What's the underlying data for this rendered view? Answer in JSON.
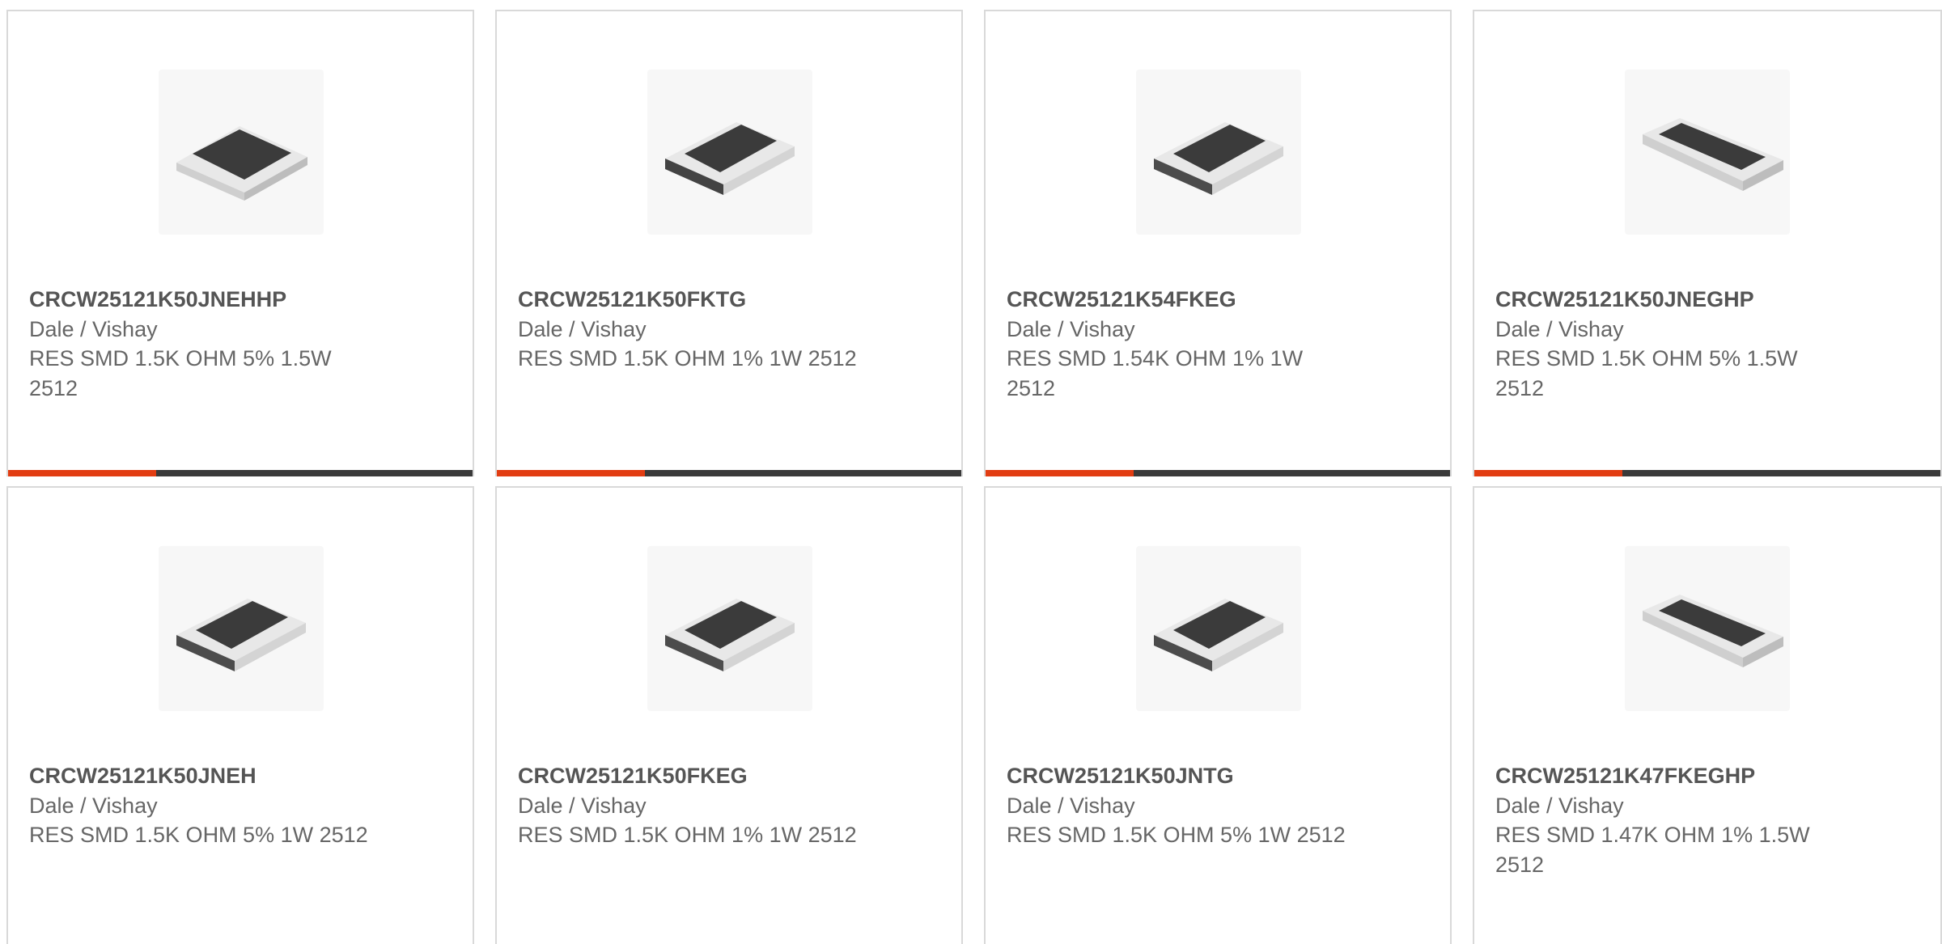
{
  "colors": {
    "accent": "#e23d12",
    "bar": "#3a3a3a",
    "border": "#d9d9d9",
    "text": "#666666",
    "part_text": "#555555"
  },
  "products": [
    {
      "part": "CRCW25121K50JNEHHP",
      "brand": "Dale / Vishay",
      "desc": "RES SMD 1.5K OHM 5% 1.5W 2512",
      "icon": "resistor-chip-icon"
    },
    {
      "part": "CRCW25121K50FKTG",
      "brand": "Dale / Vishay",
      "desc": "RES SMD 1.5K OHM 1% 1W 2512",
      "icon": "resistor-chip-icon"
    },
    {
      "part": "CRCW25121K54FKEG",
      "brand": "Dale / Vishay",
      "desc": "RES SMD 1.54K OHM 1% 1W 2512",
      "icon": "resistor-chip-icon"
    },
    {
      "part": "CRCW25121K50JNEGHP",
      "brand": "Dale / Vishay",
      "desc": "RES SMD 1.5K OHM 5% 1.5W 2512",
      "icon": "resistor-chip-icon"
    },
    {
      "part": "CRCW25121K50JNEH",
      "brand": "Dale / Vishay",
      "desc": "RES SMD 1.5K OHM 5% 1W 2512",
      "icon": "resistor-chip-icon"
    },
    {
      "part": "CRCW25121K50FKEG",
      "brand": "Dale / Vishay",
      "desc": "RES SMD 1.5K OHM 1% 1W 2512",
      "icon": "resistor-chip-icon"
    },
    {
      "part": "CRCW25121K50JNTG",
      "brand": "Dale / Vishay",
      "desc": "RES SMD 1.5K OHM 5% 1W 2512",
      "icon": "resistor-chip-icon"
    },
    {
      "part": "CRCW25121K47FKEGHP",
      "brand": "Dale / Vishay",
      "desc": "RES SMD 1.47K OHM 1% 1.5W 2512",
      "icon": "resistor-chip-icon"
    }
  ]
}
